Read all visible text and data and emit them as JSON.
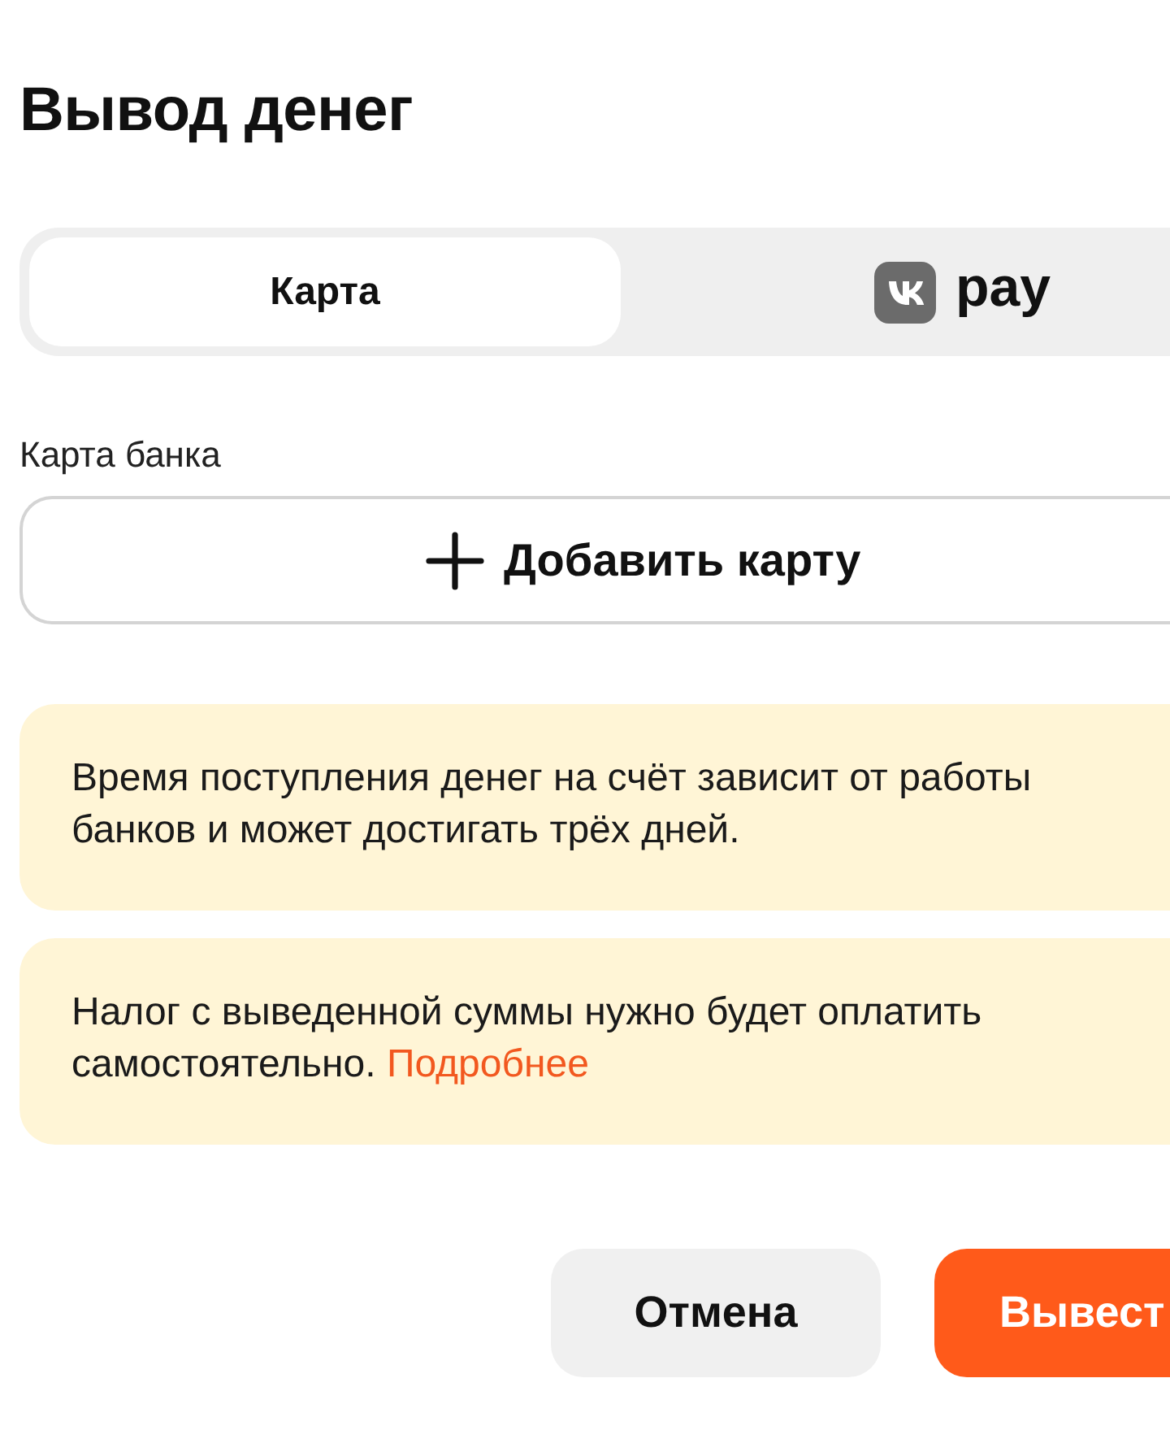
{
  "title": "Вывод денег",
  "tabs": [
    {
      "kind": "text",
      "label": "Карта",
      "selected": true
    },
    {
      "kind": "logo",
      "label": "pay",
      "selected": false
    }
  ],
  "card_field": {
    "label": "Карта банка",
    "button": "Добавить карту"
  },
  "notices": [
    {
      "text": "Время поступления денег на счёт зависит от работы банков и может достигать трёх дней."
    },
    {
      "text": "Налог с выведенной суммы нужно будет оплатить самостоятельно.",
      "link": "Подробнее"
    }
  ],
  "buttons": [
    {
      "kind": "secondary",
      "label": "Отмена"
    },
    {
      "kind": "primary",
      "label": "Вывест"
    }
  ]
}
